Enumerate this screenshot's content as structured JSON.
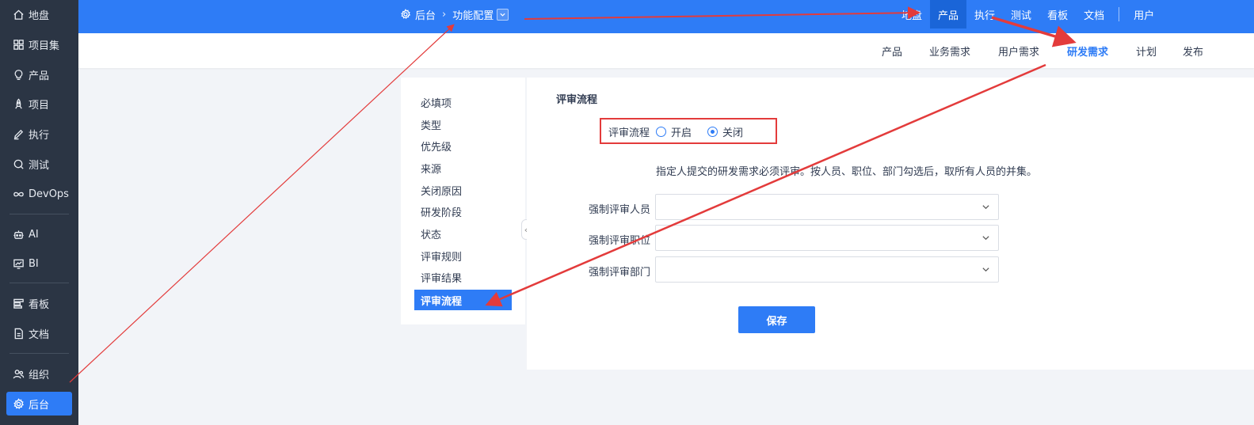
{
  "sidebar": {
    "items": [
      {
        "label": "地盘",
        "icon": "home-icon"
      },
      {
        "label": "项目集",
        "icon": "grid-icon"
      },
      {
        "label": "产品",
        "icon": "bulb-icon"
      },
      {
        "label": "项目",
        "icon": "rocket-icon"
      },
      {
        "label": "执行",
        "icon": "pen-icon"
      },
      {
        "label": "测试",
        "icon": "magnifier-icon"
      },
      {
        "label": "DevOps",
        "icon": "infinity-icon"
      },
      {
        "label": "AI",
        "icon": "robot-icon"
      },
      {
        "label": "BI",
        "icon": "chart-icon"
      },
      {
        "label": "看板",
        "icon": "kanban-icon"
      },
      {
        "label": "文档",
        "icon": "document-icon"
      },
      {
        "label": "组织",
        "icon": "people-icon"
      },
      {
        "label": "后台",
        "icon": "gear-icon",
        "active": true
      }
    ]
  },
  "header": {
    "breadcrumb": {
      "root": "后台",
      "separator": "›",
      "current": "功能配置"
    },
    "nav": [
      "地盘",
      "产品",
      "执行",
      "测试",
      "看板",
      "文档",
      "用户"
    ],
    "active_nav": "产品"
  },
  "subnav": {
    "items": [
      "产品",
      "业务需求",
      "用户需求",
      "研发需求",
      "计划",
      "发布"
    ],
    "active": "研发需求"
  },
  "config_menu": {
    "items": [
      "必填项",
      "类型",
      "优先级",
      "来源",
      "关闭原因",
      "研发阶段",
      "状态",
      "评审规则",
      "评审结果",
      "评审流程"
    ],
    "active": "评审流程"
  },
  "main": {
    "title": "评审流程",
    "review_flow": {
      "label": "评审流程",
      "option_on": "开启",
      "option_off": "关闭",
      "selected": "关闭"
    },
    "hint": "指定人提交的研发需求必须评审。按人员、职位、部门勾选后，取所有人员的并集。",
    "fields": [
      {
        "label": "强制评审人员",
        "value": ""
      },
      {
        "label": "强制评审职位",
        "value": ""
      },
      {
        "label": "强制评审部门",
        "value": ""
      }
    ],
    "save_label": "保存"
  },
  "colors": {
    "primary": "#2e7cf6",
    "sidebar_bg": "#2b3544",
    "annotation": "#e33b3b"
  }
}
